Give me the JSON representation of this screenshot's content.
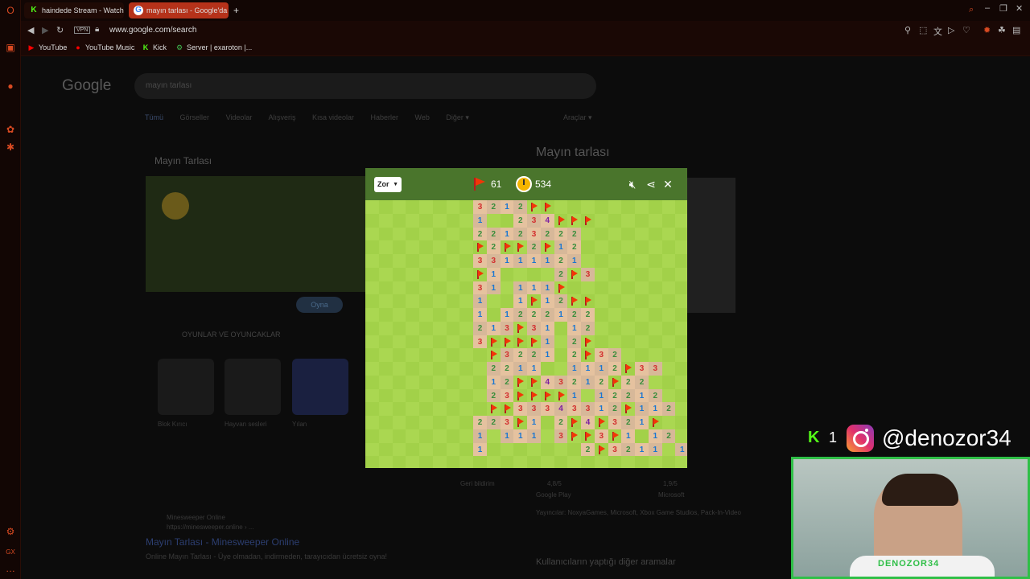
{
  "browser": {
    "tabs": [
      {
        "label": "haindede Stream - Watch",
        "icon": "kick-icon",
        "active": false
      },
      {
        "label": "mayın tarlası - Google'da",
        "icon": "google-icon",
        "active": true
      }
    ],
    "new_tab": "+",
    "url": "www.google.com/search",
    "vpn": "VPN",
    "bookmarks": [
      {
        "label": "YouTube",
        "icon": "youtube-icon"
      },
      {
        "label": "YouTube Music",
        "icon": "youtube-music-icon"
      },
      {
        "label": "Kick",
        "icon": "kick-icon"
      },
      {
        "label": "Server | exaroton |...",
        "icon": "server-icon"
      }
    ]
  },
  "google": {
    "logo": "Google",
    "query": "mayın tarlası",
    "tabs": [
      "Tümü",
      "Görseller",
      "Videolar",
      "Alışveriş",
      "Kısa videolar",
      "Haberler",
      "Web",
      "Diğer ▾"
    ],
    "tools": "Araçlar ▾",
    "card_title": "Mayın Tarlası",
    "play_button": "Oyna",
    "games_label": "OYUNLAR VE OYUNCAKLAR",
    "games": [
      "Blok Kırıcı",
      "Hayvan sesleri",
      "Yılan"
    ],
    "result_site": "Minesweeper Online",
    "result_url": "https://minesweeper.online › ...",
    "result_title": "Mayın Tarlası - Minesweeper Online",
    "result_desc": "Online Mayın Tarlası - Üye olmadan, indirmeden, tarayıcıdan ücretsiz oyna!",
    "kp_title": "Mayın tarlası",
    "kp_ratings": [
      "4,8/5",
      "1,9/5"
    ],
    "kp_rating_sources": [
      "Google Play",
      "Microsoft"
    ],
    "kp_publishers": "Yayıncılar: NoxyaGames, Microsoft, Xbox Game Studios, Pack-In-Video",
    "kp_other": "Kullanıcıların yaptığı diğer aramalar",
    "more_results": "Geri bildirim"
  },
  "game": {
    "difficulty": "Zor",
    "flags_left": "61",
    "time": "534",
    "icons": [
      "sound-muted-icon",
      "share-icon",
      "close-icon"
    ],
    "colors": {
      "light_grass": "#aad751",
      "dark_grass": "#a2d149",
      "light_dirt": "#e5c29f",
      "dark_dirt": "#d7b899",
      "header": "#4a752c"
    },
    "cell_size": 16.75,
    "rows": [
      "________3212FF___________",
      "________1__234FFF________",
      "________22123222_________",
      "________F2FF2F12__________",
      "________33111121_________",
      "________F1____2F3________",
      "________31_111F__________",
      "________1__1F12FF________",
      "________1_1222122________",
      "________213F31_12________",
      "________3FFFF1_2F________",
      "_________F3221_2F32______",
      "_________2211__1112F33___",
      "_________12FF43212F22____",
      "_________23FFFF1_12212___",
      "_________FF33343312F112__",
      "________223F1_2F4F321F___",
      "________1_111_3FF3F1_12__",
      "________1_______2F3211_1_"
    ]
  },
  "stream": {
    "kick_count": "1",
    "instagram_handle": "@denozor34",
    "cam_label": "DENOZOR34"
  }
}
